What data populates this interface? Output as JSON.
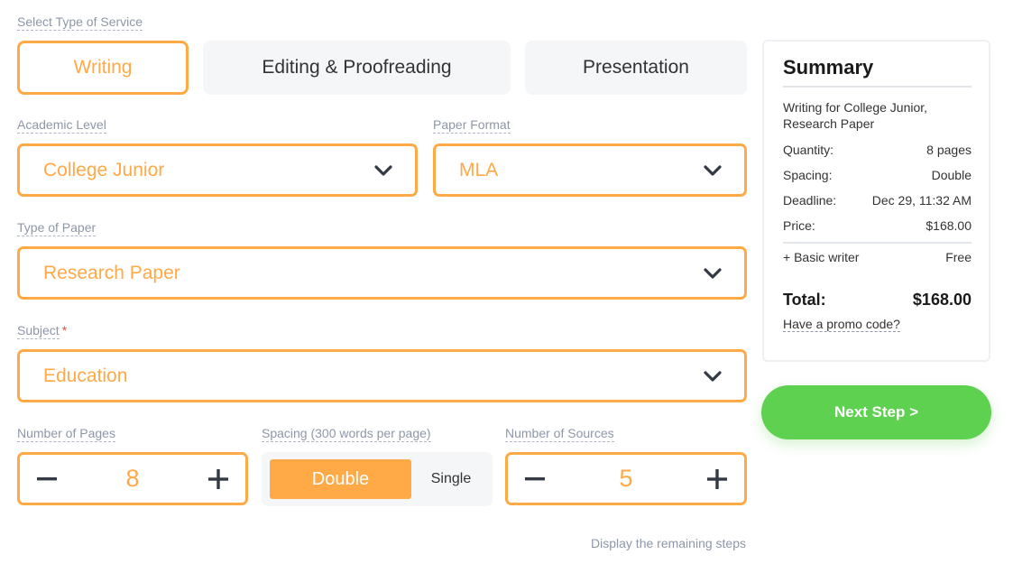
{
  "service": {
    "label": "Select Type of Service",
    "options": [
      "Writing",
      "Editing & Proofreading",
      "Presentation"
    ],
    "selected": "Writing"
  },
  "academic_level": {
    "label": "Academic Level",
    "value": "College Junior"
  },
  "paper_format": {
    "label": "Paper Format",
    "value": "MLA"
  },
  "type_of_paper": {
    "label": "Type of Paper",
    "value": "Research Paper"
  },
  "subject": {
    "label": "Subject",
    "required_mark": "*",
    "value": "Education"
  },
  "pages": {
    "label": "Number of Pages",
    "value": "8"
  },
  "spacing": {
    "label": "Spacing (300 words per page)",
    "selected": "Double",
    "other": "Single"
  },
  "sources": {
    "label": "Number of Sources",
    "value": "5"
  },
  "remaining_link": "Display the remaining steps",
  "summary": {
    "title": "Summary",
    "description": "Writing for College Junior, Research Paper",
    "rows": [
      {
        "label": "Quantity:",
        "value": "8 pages"
      },
      {
        "label": "Spacing:",
        "value": "Double"
      },
      {
        "label": "Deadline:",
        "value": "Dec 29, 11:32 AM"
      },
      {
        "label": "Price:",
        "value": "$168.00"
      }
    ],
    "extra": {
      "label": "+ Basic writer",
      "value": "Free"
    },
    "total_label": "Total:",
    "total_value": "$168.00",
    "promo": "Have a promo code?"
  },
  "next_button": "Next Step >",
  "colors": {
    "accent": "#ffa947",
    "green": "#5fd150",
    "muted": "#8e97a8",
    "panel": "#f5f6f8"
  }
}
